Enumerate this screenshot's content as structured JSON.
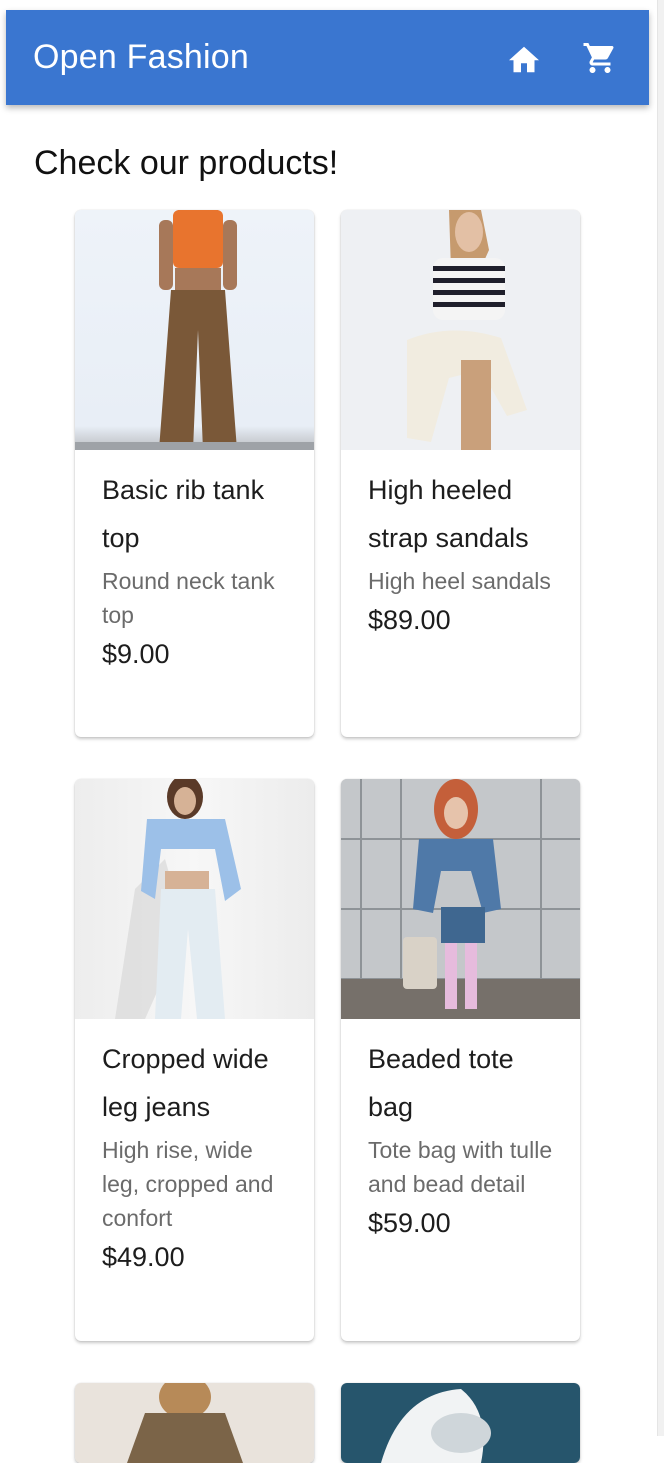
{
  "header": {
    "title": "Open Fashion",
    "home_icon": "home-icon",
    "cart_icon": "shopping-cart-icon",
    "bar_color": "#3a76d0"
  },
  "main": {
    "heading": "Check our products!"
  },
  "products": [
    {
      "title": "Basic rib tank top",
      "description": "Round neck tank top",
      "price": "$9.00"
    },
    {
      "title": "High heeled strap sandals",
      "description": "High heel sandals",
      "price": "$89.00"
    },
    {
      "title": "Cropped wide leg jeans",
      "description": "High rise, wide leg, cropped and confort",
      "price": "$49.00"
    },
    {
      "title": "Beaded tote bag",
      "description": "Tote bag with tulle and bead detail",
      "price": "$59.00"
    }
  ]
}
